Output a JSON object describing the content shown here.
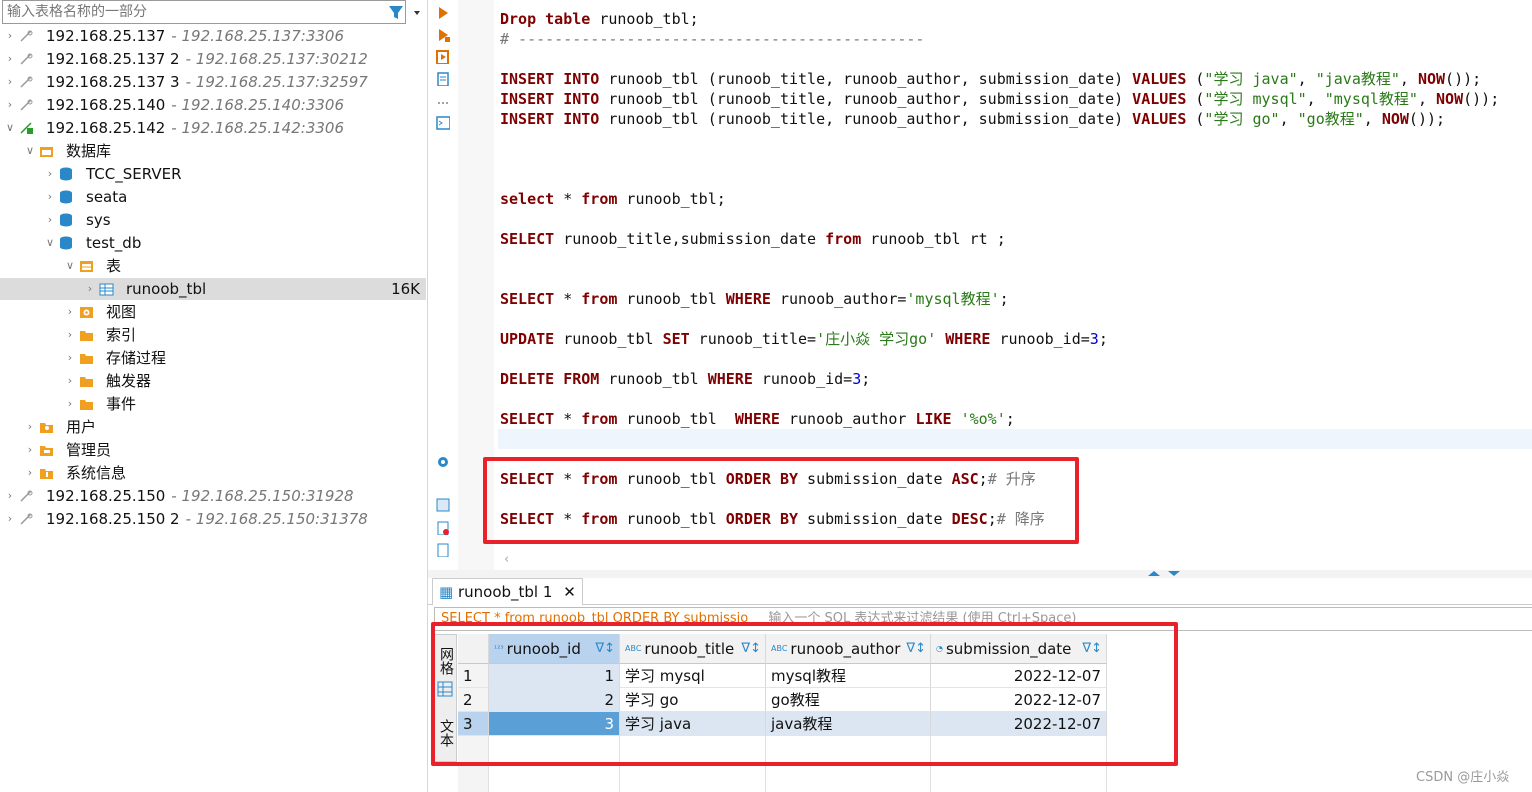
{
  "navigator": {
    "filter_placeholder": "输入表格名称的一部分",
    "items": [
      {
        "label": "192.168.25.137",
        "addr": "- 192.168.25.137:3306"
      },
      {
        "label": "192.168.25.137 2",
        "addr": "- 192.168.25.137:30212"
      },
      {
        "label": "192.168.25.137 3",
        "addr": "- 192.168.25.137:32597"
      },
      {
        "label": "192.168.25.140",
        "addr": "- 192.168.25.140:3306"
      },
      {
        "label": "192.168.25.142",
        "addr": "- 192.168.25.142:3306"
      },
      {
        "label": "数据库"
      },
      {
        "label": "TCC_SERVER"
      },
      {
        "label": "seata"
      },
      {
        "label": "sys"
      },
      {
        "label": "test_db"
      },
      {
        "label": "表"
      },
      {
        "label": "runoob_tbl",
        "size": "16K"
      },
      {
        "label": "视图"
      },
      {
        "label": "索引"
      },
      {
        "label": "存储过程"
      },
      {
        "label": "触发器"
      },
      {
        "label": "事件"
      },
      {
        "label": "用户"
      },
      {
        "label": "管理员"
      },
      {
        "label": "系统信息"
      },
      {
        "label": "192.168.25.150",
        "addr": "- 192.168.25.150:31928"
      },
      {
        "label": "192.168.25.150 2",
        "addr": "- 192.168.25.150:31378"
      }
    ]
  },
  "editor": {
    "lines": [
      [
        {
          "t": "Drop table",
          "c": "kw"
        },
        {
          "t": " runoob_tbl;"
        }
      ],
      [
        {
          "t": "# ---------------------------------------------",
          "c": "cmt"
        }
      ],
      [
        {
          "t": "INSERT INTO",
          "c": "kw"
        },
        {
          "t": " runoob_tbl (runoob_title, runoob_author, submission_date) "
        },
        {
          "t": "VALUES",
          "c": "kw"
        },
        {
          "t": " ("
        },
        {
          "t": "\"学习 java\"",
          "c": "str"
        },
        {
          "t": ", "
        },
        {
          "t": "\"java教程\"",
          "c": "str"
        },
        {
          "t": ", "
        },
        {
          "t": "NOW",
          "c": "kw"
        },
        {
          "t": "());"
        }
      ],
      [
        {
          "t": "INSERT INTO",
          "c": "kw"
        },
        {
          "t": " runoob_tbl (runoob_title, runoob_author, submission_date) "
        },
        {
          "t": "VALUES",
          "c": "kw"
        },
        {
          "t": " ("
        },
        {
          "t": "\"学习 mysql\"",
          "c": "str"
        },
        {
          "t": ", "
        },
        {
          "t": "\"mysql教程\"",
          "c": "str"
        },
        {
          "t": ", "
        },
        {
          "t": "NOW",
          "c": "kw"
        },
        {
          "t": "());"
        }
      ],
      [
        {
          "t": "INSERT INTO",
          "c": "kw"
        },
        {
          "t": " runoob_tbl (runoob_title, runoob_author, submission_date) "
        },
        {
          "t": "VALUES",
          "c": "kw"
        },
        {
          "t": " ("
        },
        {
          "t": "\"学习 go\"",
          "c": "str"
        },
        {
          "t": ", "
        },
        {
          "t": "\"go教程\"",
          "c": "str"
        },
        {
          "t": ", "
        },
        {
          "t": "NOW",
          "c": "kw"
        },
        {
          "t": "());"
        }
      ],
      [
        {
          "t": "select",
          "c": "kw"
        },
        {
          "t": " * "
        },
        {
          "t": "from",
          "c": "kw"
        },
        {
          "t": " runoob_tbl;"
        }
      ],
      [
        {
          "t": "SELECT",
          "c": "kw"
        },
        {
          "t": " runoob_title,submission_date "
        },
        {
          "t": "from",
          "c": "kw"
        },
        {
          "t": " runoob_tbl rt ;"
        }
      ],
      [
        {
          "t": "SELECT",
          "c": "kw"
        },
        {
          "t": " * "
        },
        {
          "t": "from",
          "c": "kw"
        },
        {
          "t": " runoob_tbl "
        },
        {
          "t": "WHERE",
          "c": "kw"
        },
        {
          "t": " runoob_author="
        },
        {
          "t": "'mysql教程'",
          "c": "str"
        },
        {
          "t": ";"
        }
      ],
      [
        {
          "t": "UPDATE",
          "c": "kw"
        },
        {
          "t": " runoob_tbl "
        },
        {
          "t": "SET",
          "c": "kw"
        },
        {
          "t": " runoob_title="
        },
        {
          "t": "'庄小焱 学习go'",
          "c": "str"
        },
        {
          "t": " "
        },
        {
          "t": "WHERE",
          "c": "kw"
        },
        {
          "t": " runoob_id="
        },
        {
          "t": "3",
          "c": "num"
        },
        {
          "t": ";"
        }
      ],
      [
        {
          "t": "DELETE FROM",
          "c": "kw"
        },
        {
          "t": " runoob_tbl "
        },
        {
          "t": "WHERE",
          "c": "kw"
        },
        {
          "t": " runoob_id="
        },
        {
          "t": "3",
          "c": "num"
        },
        {
          "t": ";"
        }
      ],
      [
        {
          "t": "SELECT",
          "c": "kw"
        },
        {
          "t": " * "
        },
        {
          "t": "from",
          "c": "kw"
        },
        {
          "t": " runoob_tbl  "
        },
        {
          "t": "WHERE",
          "c": "kw"
        },
        {
          "t": " runoob_author "
        },
        {
          "t": "LIKE",
          "c": "kw"
        },
        {
          "t": " "
        },
        {
          "t": "'%o%'",
          "c": "str"
        },
        {
          "t": ";"
        }
      ],
      [
        {
          "t": "SELECT",
          "c": "kw"
        },
        {
          "t": " * "
        },
        {
          "t": "from",
          "c": "kw"
        },
        {
          "t": " runoob_tbl "
        },
        {
          "t": "ORDER BY",
          "c": "kw"
        },
        {
          "t": " submission_date "
        },
        {
          "t": "ASC",
          "c": "kw"
        },
        {
          "t": ";"
        },
        {
          "t": "# 升序",
          "c": "cmt"
        }
      ],
      [
        {
          "t": "SELECT",
          "c": "kw"
        },
        {
          "t": " * "
        },
        {
          "t": "from",
          "c": "kw"
        },
        {
          "t": " runoob_tbl "
        },
        {
          "t": "ORDER BY",
          "c": "kw"
        },
        {
          "t": " submission_date "
        },
        {
          "t": "DESC",
          "c": "kw"
        },
        {
          "t": ";"
        },
        {
          "t": "# 降序",
          "c": "cmt"
        }
      ]
    ]
  },
  "results": {
    "tab_label": "runoob_tbl 1",
    "query_text": "SELECT * from runoob_tbl ORDER BY submissio",
    "filter_placeholder": "输入一个 SQL 表达式来过滤结果 (使用 Ctrl+Space)",
    "side_tabs": [
      "网格",
      "文本"
    ],
    "columns": [
      {
        "name": "runoob_id",
        "type": "123"
      },
      {
        "name": "runoob_title",
        "type": "ABC"
      },
      {
        "name": "runoob_author",
        "type": "ABC"
      },
      {
        "name": "submission_date",
        "type": "date"
      }
    ],
    "rows": [
      {
        "n": "1",
        "id": "1",
        "title": "学习 mysql",
        "author": "mysql教程",
        "date": "2022-12-07"
      },
      {
        "n": "2",
        "id": "2",
        "title": "学习 go",
        "author": "go教程",
        "date": "2022-12-07"
      },
      {
        "n": "3",
        "id": "3",
        "title": "学习 java",
        "author": "java教程",
        "date": "2022-12-07"
      }
    ]
  },
  "watermark": "CSDN @庄小焱",
  "colors": {
    "highlight_box": "#e8212b",
    "keyword": "#7f0000",
    "string": "#2a7a18",
    "number": "#0000cc",
    "selection": "#5a9fd6"
  }
}
